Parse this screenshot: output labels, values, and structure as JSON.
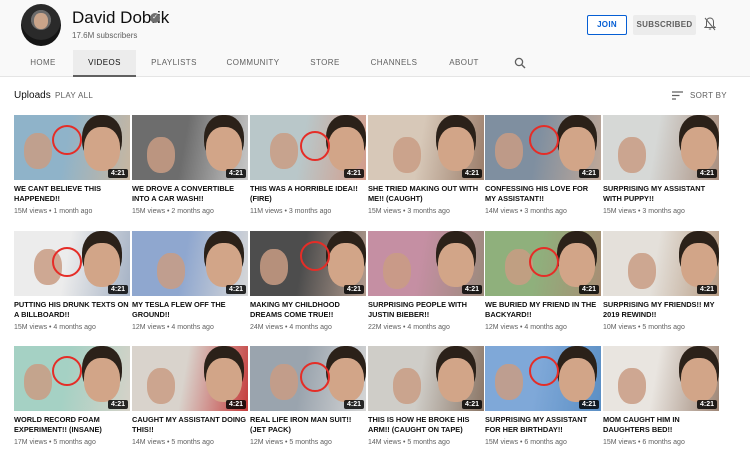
{
  "channel": {
    "name": "David Dobrik",
    "subscribers": "17.6M subscribers",
    "join_label": "JOIN",
    "subscribed_label": "SUBSCRIBED"
  },
  "tabs": [
    {
      "label": "HOME"
    },
    {
      "label": "VIDEOS"
    },
    {
      "label": "PLAYLISTS"
    },
    {
      "label": "COMMUNITY"
    },
    {
      "label": "STORE"
    },
    {
      "label": "CHANNELS"
    },
    {
      "label": "ABOUT"
    }
  ],
  "section": {
    "title": "Uploads",
    "play_all": "PLAY ALL",
    "sort_by": "SORT BY"
  },
  "icons": {
    "verified": "verified-check-icon",
    "bell": "bell-off-icon",
    "search": "search-icon",
    "sort": "sort-icon"
  },
  "colors": {
    "accent_blue": "#065fd4",
    "subscribed_gray": "#ececec",
    "header_bg": "#f9f9f9",
    "circle_red": "#e52d27"
  },
  "videos": [
    {
      "title": "WE CANT BELIEVE THIS HAPPENED!!",
      "views": "15M views",
      "age": "1 month ago",
      "duration": "4:21"
    },
    {
      "title": "WE DROVE A CONVERTIBLE INTO A CAR WASH!!",
      "views": "15M views",
      "age": "2 months ago",
      "duration": "4:21"
    },
    {
      "title": "THIS WAS A HORRIBLE IDEA!! (FIRE)",
      "views": "11M views",
      "age": "3 months ago",
      "duration": "4:21"
    },
    {
      "title": "SHE TRIED MAKING OUT WITH ME!! (CAUGHT)",
      "views": "15M views",
      "age": "3 months ago",
      "duration": "4:21"
    },
    {
      "title": "CONFESSING HIS LOVE FOR MY ASSISTANT!!",
      "views": "14M views",
      "age": "3 months ago",
      "duration": "4:21"
    },
    {
      "title": "SURPRISING MY ASSISTANT WITH PUPPY!!",
      "views": "15M views",
      "age": "3 months ago",
      "duration": "4:21"
    },
    {
      "title": "PUTTING HIS DRUNK TEXTS ON A BILLBOARD!!",
      "views": "15M views",
      "age": "4 months ago",
      "duration": "4:21"
    },
    {
      "title": "MY TESLA FLEW OFF THE GROUND!!",
      "views": "12M views",
      "age": "4 months ago",
      "duration": "4:21"
    },
    {
      "title": "MAKING MY CHILDHOOD DREAMS COME TRUE!!",
      "views": "24M views",
      "age": "4 months ago",
      "duration": "4:21"
    },
    {
      "title": "SURPRISING PEOPLE WITH JUSTIN BIEBER!!",
      "views": "22M views",
      "age": "4 months ago",
      "duration": "4:21"
    },
    {
      "title": "WE BURIED MY FRIEND IN THE BACKYARD!!",
      "views": "12M views",
      "age": "4 months ago",
      "duration": "4:21"
    },
    {
      "title": "SURPRISING MY FRIENDS!! MY 2019 REWIND!!",
      "views": "10M views",
      "age": "5 months ago",
      "duration": "4:21"
    },
    {
      "title": "WORLD RECORD FOAM EXPERIMENT!! (INSANE)",
      "views": "17M views",
      "age": "5 months ago",
      "duration": "4:21"
    },
    {
      "title": "CAUGHT MY ASSISTANT DOING THIS!!",
      "views": "14M views",
      "age": "5 months ago",
      "duration": "4:21"
    },
    {
      "title": "REAL LIFE IRON MAN SUIT!! (JET PACK)",
      "views": "12M views",
      "age": "5 months ago",
      "duration": "4:21"
    },
    {
      "title": "THIS IS HOW HE BROKE HIS ARM!! (CAUGHT ON TAPE)",
      "views": "14M views",
      "age": "5 months ago",
      "duration": "4:21"
    },
    {
      "title": "SURPRISING MY ASSISTANT FOR HER BIRTHDAY!!",
      "views": "15M views",
      "age": "6 months ago",
      "duration": "4:21"
    },
    {
      "title": "MOM CAUGHT HIM IN DAUGHTERS BED!!",
      "views": "15M views",
      "age": "6 months ago",
      "duration": "4:21"
    }
  ]
}
